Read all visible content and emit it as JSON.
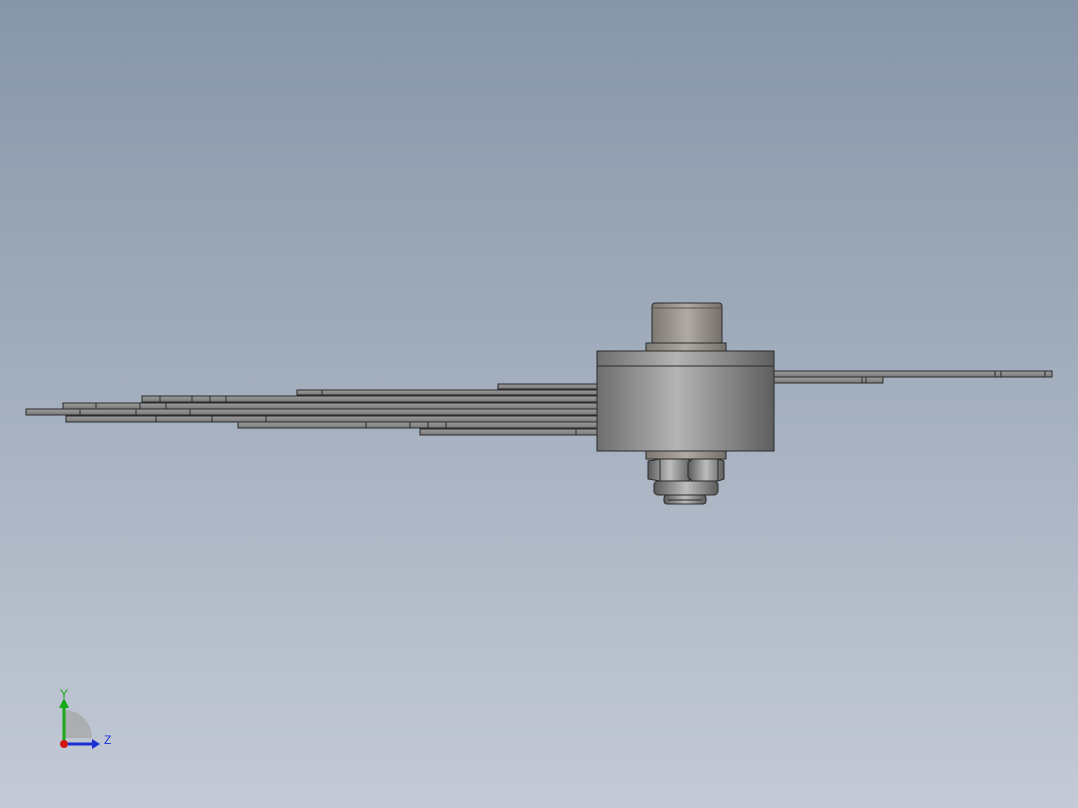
{
  "viewport": {
    "background_top": "#8696a8",
    "background_bottom": "#c4cad6"
  },
  "model": {
    "description_icon": "cad-assembly-side-view",
    "part_color": "#8a8a8a",
    "part_edge_color": "#2a2a2a"
  },
  "triad": {
    "icon": "coordinate-triad-icon",
    "y_label": "Y",
    "z_label": "Z",
    "y_color": "#18a818",
    "z_color": "#1a2fd8",
    "x_color": "#d01818"
  }
}
